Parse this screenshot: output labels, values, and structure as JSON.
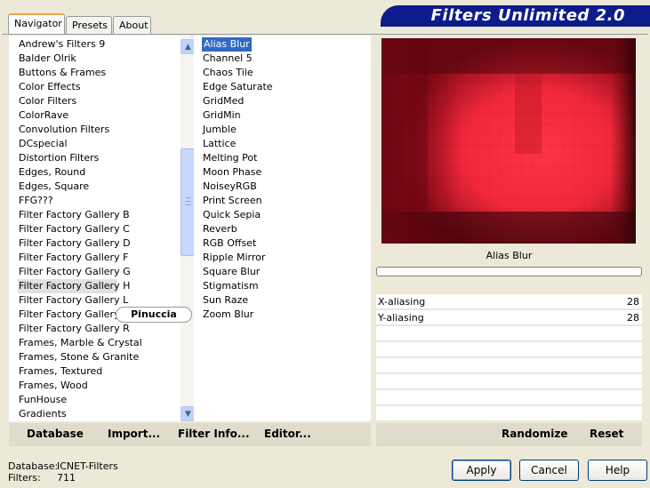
{
  "tabs": [
    {
      "label": "Navigator",
      "active": true
    },
    {
      "label": "Presets",
      "active": false
    },
    {
      "label": "About",
      "active": false
    }
  ],
  "brand": {
    "title": "Filters Unlimited 2.0",
    "color": "#0d1c8a"
  },
  "categories": {
    "items": [
      "Andrew's Filters 9",
      "Balder Olrik",
      "Buttons & Frames",
      "Color Effects",
      "Color Filters",
      "ColorRave",
      "Convolution Filters",
      "DCspecial",
      "Distortion Filters",
      "Edges, Round",
      "Edges, Square",
      "FFG???",
      "Filter Factory Gallery B",
      "Filter Factory Gallery C",
      "Filter Factory Gallery D",
      "Filter Factory Gallery F",
      "Filter Factory Gallery G",
      "Filter Factory Gallery H",
      "Filter Factory Gallery L",
      "Filter Factory Gallery Q",
      "Filter Factory Gallery R",
      "Frames, Marble & Crystal",
      "Frames, Stone & Granite",
      "Frames, Textured",
      "Frames, Wood",
      "FunHouse",
      "Gradients"
    ],
    "selected_index": 17
  },
  "filters": {
    "items": [
      "Alias Blur",
      "Channel 5",
      "Chaos Tile",
      "Edge Saturate",
      "GridMed",
      "GridMin",
      "Jumble",
      "Lattice",
      "Melting Pot",
      "Moon Phase",
      "NoiseyRGB",
      "Print Screen",
      "Quick Sepia",
      "Reverb",
      "RGB Offset",
      "Ripple Mirror",
      "Square Blur",
      "Stigmatism",
      "Sun Raze",
      "Zoom Blur"
    ],
    "selected_index": 0
  },
  "preview": {
    "filter_name": "Alias Blur"
  },
  "params": [
    {
      "label": "X-aliasing",
      "value": "28"
    },
    {
      "label": "Y-aliasing",
      "value": "28"
    }
  ],
  "left_actions": {
    "database": "Database",
    "import": "Import...",
    "filter_info": "Filter Info...",
    "editor": "Editor..."
  },
  "right_actions": {
    "randomize": "Randomize",
    "reset": "Reset"
  },
  "status": {
    "database_label": "Database:",
    "database_value": "ICNET-Filters",
    "filters_label": "Filters:",
    "filters_value": "711"
  },
  "dialog_buttons": {
    "apply": "Apply",
    "cancel": "Cancel",
    "help": "Help"
  },
  "watermark": "Pinuccia"
}
